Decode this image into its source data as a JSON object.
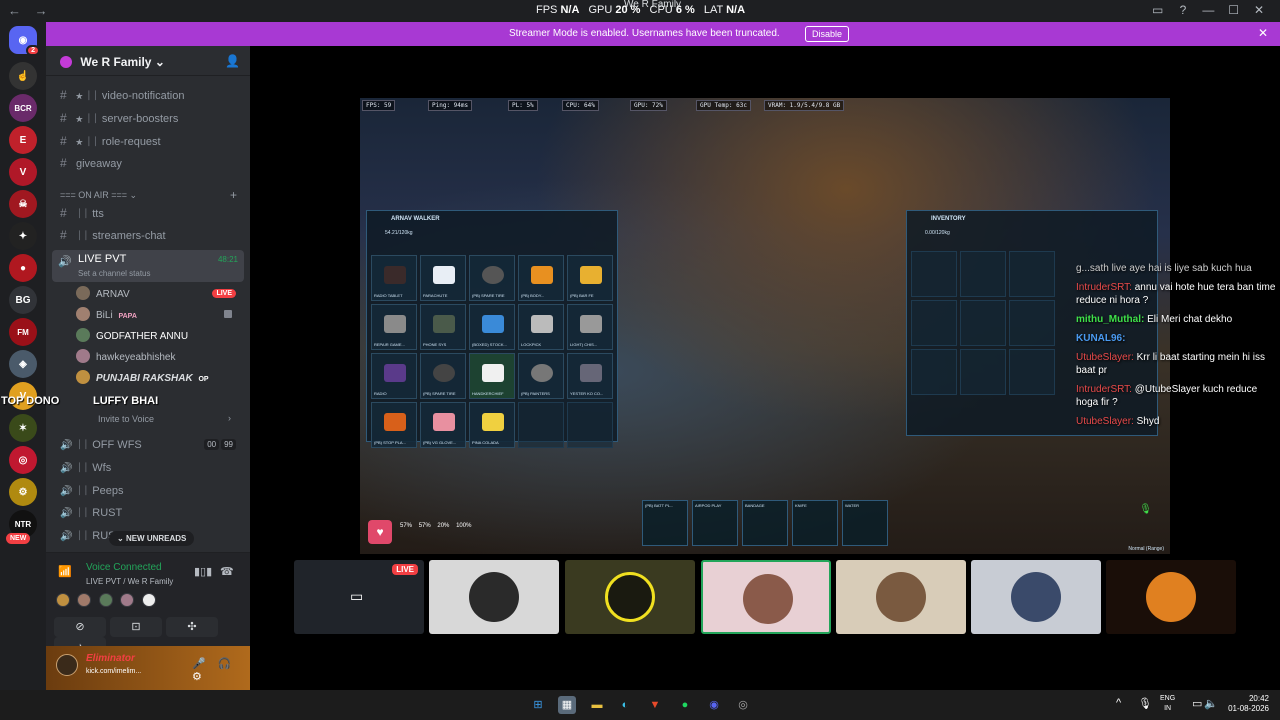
{
  "topbar": {
    "stats": {
      "fps_label": "FPS",
      "fps_value": "N/A",
      "gpu_label": "GPU",
      "gpu_value": "20 %",
      "cpu_label": "CPU",
      "cpu_value": "6 %",
      "lat_label": "LAT",
      "lat_value": "N/A"
    },
    "title": "We R Family"
  },
  "banner": {
    "message": "Streamer Mode is enabled. Usernames have been truncated.",
    "button": "Disable"
  },
  "servers": {
    "home_badge": "2",
    "items": [
      "BCR",
      "BG",
      "FM",
      "NTR"
    ],
    "new_tag": "NEW"
  },
  "guild": {
    "name": "We R Family"
  },
  "channels": [
    {
      "name": "★ ᛁᛁ video-notification"
    },
    {
      "name": "★ ᛁᛁ server-boosters"
    },
    {
      "name": "★ ᛁᛁ role-request"
    },
    {
      "name": "giveaway"
    }
  ],
  "category": {
    "name": "=== ON AIR ==="
  },
  "text_channels": [
    {
      "name": "ᛁᛁ tts"
    },
    {
      "name": "ᛁᛁ streamers-chat"
    }
  ],
  "live_channel": {
    "name": "LIVE PVT",
    "status": "Set a channel status",
    "time": "48:21"
  },
  "voice_users": [
    {
      "name": "ARNAV",
      "tag": "",
      "live": "LIVE"
    },
    {
      "name": "BiLi",
      "tag": "PAPA",
      "live": ""
    },
    {
      "name": "GODFATHER ANNU",
      "tag": "",
      "live": ""
    },
    {
      "name": "hawkeyeabhishek",
      "tag": "",
      "live": ""
    },
    {
      "name": "PUNJABI RAKSHAK",
      "tag": "OP",
      "live": ""
    }
  ],
  "overlay_names": {
    "a": "TOP DONO",
    "b": "LUFFY BHAI"
  },
  "invite_voice": "Invite to Voice",
  "voice_channels": [
    {
      "name": "ᛁᛁ OFF WFS",
      "c1": "00",
      "c2": "99"
    },
    {
      "name": "ᛁᛁ Wfs"
    },
    {
      "name": "ᛁᛁ Peeps"
    },
    {
      "name": "ᛁᛁ RUST"
    },
    {
      "name": "ᛁᛁ RUST"
    }
  ],
  "new_unreads": "NEW UNREADS",
  "voice_panel": {
    "title": "Voice Connected",
    "subtitle": "LIVE PVT / We R Family"
  },
  "user": {
    "name": "Eliminator",
    "status": "kick.com/imelim..."
  },
  "hud": {
    "fps": "FPS: 59",
    "ping": "Ping: 94ms",
    "pl": "PL: 5%",
    "cpu": "CPU: 64%",
    "gpu": "GPU: 72%",
    "gpu_temp": "GPU Temp: 63c",
    "vram": "VRAM: 1.9/5.4/9.8 GB"
  },
  "inventory_left": {
    "title": "ARNAV WALKER",
    "weight": "54.21/120kg",
    "items": [
      "RADIO TABLET",
      "PARACHUTE",
      "(PB) SPARE TIRE",
      "(PB) BODY...",
      "(PB) BAR FE",
      "REPAIR GAME...",
      "PHONE SYS",
      "(BOXED) STOCK...",
      "LOCKPICK",
      "LIGHT) CHIS...",
      "RADIO",
      "(PB) SPARE TIRE",
      "HANDKERCHIEF",
      "(PB) PAINTERS",
      "YESTER KO CO...",
      "(PB) STOP PLA...",
      "(PB) VG GLOVE...",
      "PINA COLADA"
    ]
  },
  "inventory_right": {
    "title": "INVENTORY",
    "weight": "0.00/120kg"
  },
  "chat": [
    {
      "user": "",
      "text": "g...sath live aye hai is liye sab kuch hua"
    },
    {
      "user": "IntruderSRT:",
      "text": "annu vai hote hue tera ban time reduce ni hora ?"
    },
    {
      "user": "mithu_Muthal:",
      "text": "Eli Meri chat dekho"
    },
    {
      "user": "KUNAL96:",
      "text": ""
    },
    {
      "user": "UtubeSlayer:",
      "text": "Krr li baat starting mein hi iss baat pr"
    },
    {
      "user": "IntruderSRT:",
      "text": "@UtubeSlayer kuch reduce hoga fir ?"
    },
    {
      "user": "UtubeSlayer:",
      "text": "Shyd"
    }
  ],
  "vitals": {
    "armor": "57%",
    "water": "57%",
    "food": "20%",
    "stamina": "100%"
  },
  "hotbar": [
    "(PB) BATT PL...",
    "AIRPOD PLAY",
    "BANDAGE",
    "KNIFE",
    "WATER"
  ],
  "mode": "Normal (Range)",
  "thumbs": [
    {
      "live": "LIVE"
    }
  ],
  "taskbar": {
    "lang1": "ENG",
    "lang2": "IN",
    "time": "20:42",
    "date": "01-08-2026"
  }
}
